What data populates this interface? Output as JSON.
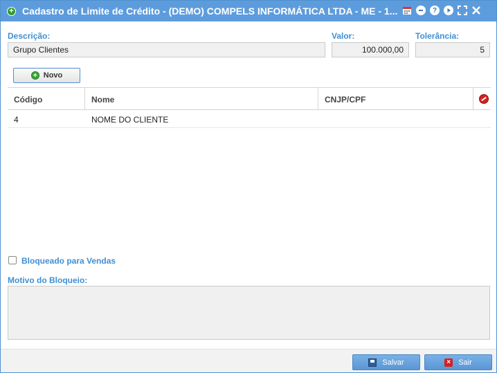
{
  "window": {
    "title": "Cadastro de Limite de Crédito - (DEMO) COMPELS INFORMÁTICA LTDA - ME - 1...",
    "title_icon": "add-circle-icon",
    "tools": [
      "calendar-icon",
      "minimize-icon",
      "help-icon",
      "next-icon",
      "maximize-icon",
      "close-icon"
    ]
  },
  "form": {
    "descricao_label": "Descrição:",
    "descricao_value": "Grupo Clientes",
    "valor_label": "Valor:",
    "valor_value": "100.000,00",
    "tolerancia_label": "Tolerância:",
    "tolerancia_value": "5"
  },
  "toolbar": {
    "novo_label": "Novo"
  },
  "grid": {
    "columns": [
      "Código",
      "Nome",
      "CNJP/CPF"
    ],
    "rows": [
      {
        "codigo": "4",
        "nome": "NOME DO CLIENTE",
        "cnpj": ""
      }
    ]
  },
  "bloqueio": {
    "checkbox_label": "Bloqueado para Vendas",
    "checked": false,
    "motivo_label": "Motivo do Bloqueio:",
    "motivo_value": ""
  },
  "footer": {
    "salvar_label": "Salvar",
    "sair_label": "Sair"
  },
  "colors": {
    "titlebar": "#5d9cdc",
    "label_blue": "#3f8fd2",
    "button_blue": "#5b97d4"
  }
}
